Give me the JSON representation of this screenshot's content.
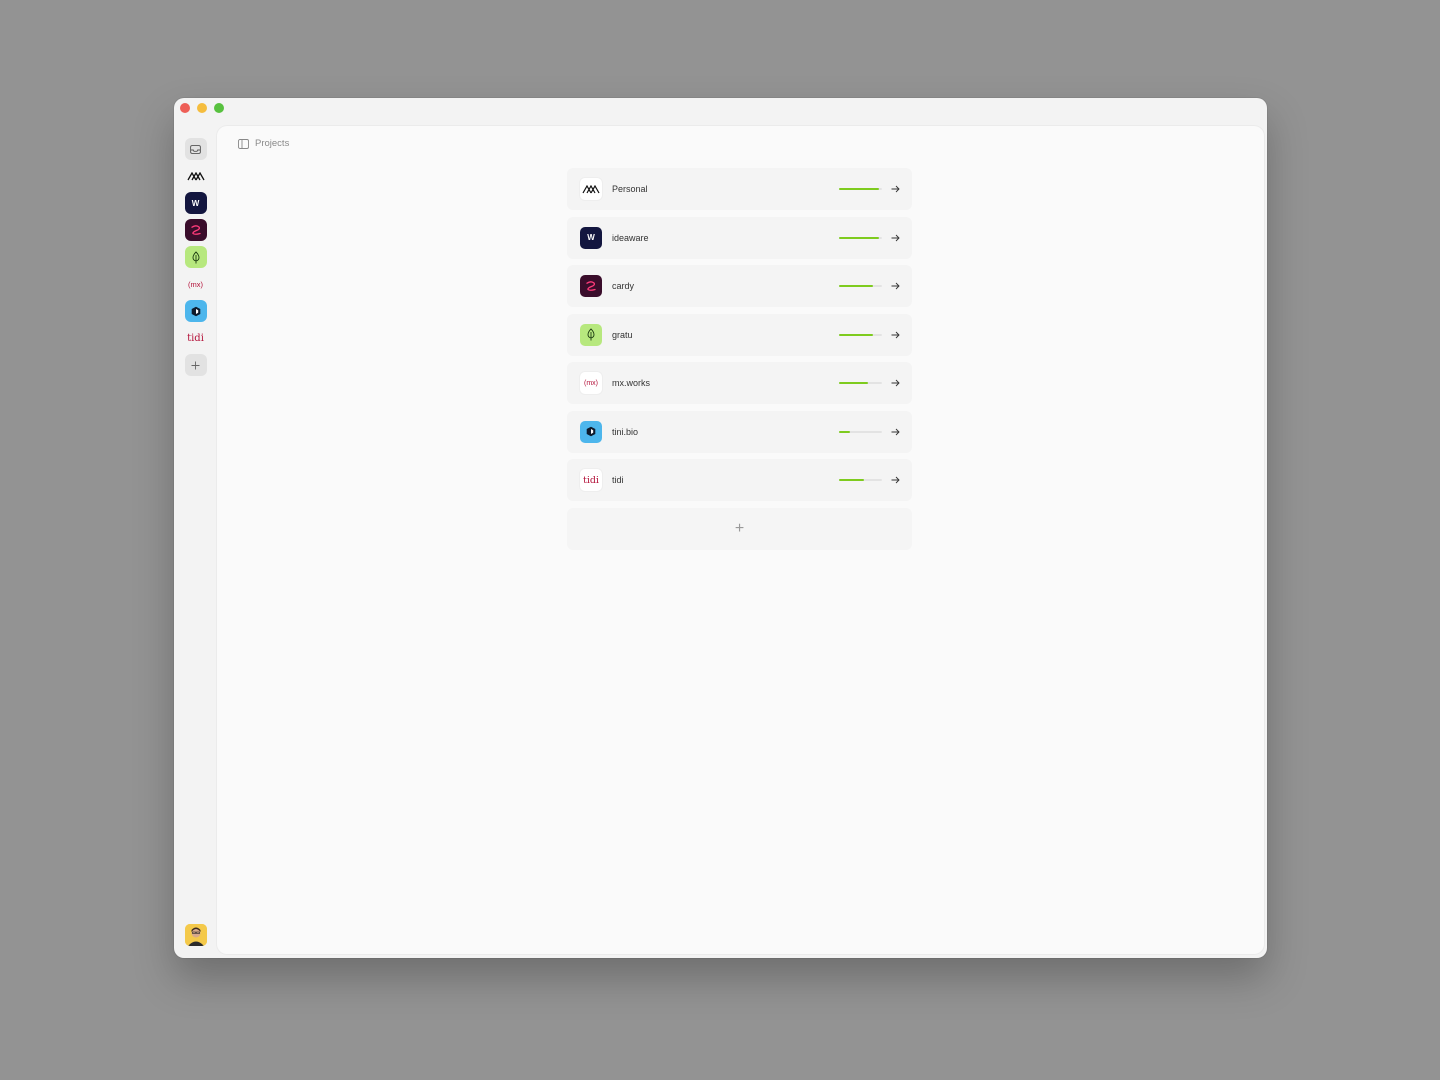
{
  "breadcrumb": {
    "title": "Projects",
    "icon": "sidebar-toggle-icon"
  },
  "rail": {
    "items": [
      {
        "id": "inbox",
        "icon": "inbox-icon"
      },
      {
        "id": "personal",
        "icon": "mountain-logo-icon"
      },
      {
        "id": "ideaware",
        "icon": "ideaware-logo-icon",
        "text": "W"
      },
      {
        "id": "cardy",
        "icon": "cardy-logo-icon"
      },
      {
        "id": "gratu",
        "icon": "leaf-logo-icon"
      },
      {
        "id": "mxworks",
        "icon": "mx-logo-icon",
        "text": "(mx)"
      },
      {
        "id": "tinibio",
        "icon": "cube-logo-icon"
      },
      {
        "id": "tidi",
        "icon": "tidi-logo-icon",
        "text": "tidi"
      },
      {
        "id": "add",
        "icon": "plus-icon"
      }
    ],
    "avatar": "user-avatar"
  },
  "projects": [
    {
      "name": "Personal",
      "logo": "mountain-logo-icon",
      "progress": 0.93
    },
    {
      "name": "ideaware",
      "logo": "ideaware-logo-icon",
      "logo_text": "W",
      "progress": 0.93
    },
    {
      "name": "cardy",
      "logo": "cardy-logo-icon",
      "progress": 0.8
    },
    {
      "name": "gratu",
      "logo": "leaf-logo-icon",
      "progress": 0.8
    },
    {
      "name": "mx.works",
      "logo": "mx-logo-icon",
      "logo_text": "(mx)",
      "progress": 0.67
    },
    {
      "name": "tini.bio",
      "logo": "cube-logo-icon",
      "progress": 0.25
    },
    {
      "name": "tidi",
      "logo": "tidi-logo-icon",
      "logo_text": "tidi",
      "progress": 0.58
    }
  ],
  "add_project_label": "+",
  "colors": {
    "progress_fill": "#7ecb1e",
    "ideaware_bg": "#13163f",
    "cardy_bg": "#3a0d2b",
    "cardy_fg": "#ff3b7a",
    "gratu_bg": "#b7e87e",
    "mx_fg": "#b4123a",
    "tini_bg": "#4db6ec",
    "tidi_fg": "#b4123a"
  }
}
